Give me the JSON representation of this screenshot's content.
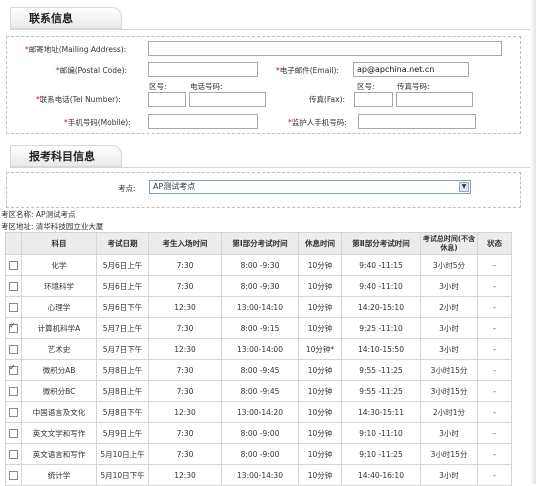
{
  "contact": {
    "title": "联系信息",
    "address_label": "邮寄地址(Mailing Address):",
    "address_value": "",
    "postal_label": "邮编(Postal Code):",
    "postal_value": "",
    "email_label": "电子邮件(Email):",
    "email_value": "ap@apchina.net.cn",
    "tel_label": "联系电话(Tel Number):",
    "area_code_label": "区号:",
    "phone_label": "电话号码:",
    "fax_label": "传真(Fax):",
    "fax_area_label": "区号:",
    "fax_number_label": "传真号码:",
    "mobile_label": "手机号码(Mobile):",
    "guardian_label": "监护人手机号码:"
  },
  "exam": {
    "title": "报考科目信息",
    "site_label": "考点:",
    "site_selected": "AP测试考点",
    "site_name_line": "考区名称: AP测试考点",
    "site_address_line": "考区地址: 清华科技园立业大厦"
  },
  "table": {
    "headers": [
      "科目",
      "考试日期",
      "考生入场时间",
      "第Ⅰ部分考试时间",
      "休息时间",
      "第Ⅱ部分考试时间",
      "考试总时间(不含休息)",
      "状态"
    ],
    "rows": [
      {
        "checked": false,
        "subject": "化学",
        "date": "5月6日上午",
        "entry": "7:30",
        "part1": "8:00 -9:30",
        "break": "10分钟",
        "part2": "9:40 -11:15",
        "total": "3小时5分",
        "status": "-"
      },
      {
        "checked": false,
        "subject": "环境科学",
        "date": "5月6日上午",
        "entry": "7:30",
        "part1": "8:00 -9:30",
        "break": "10分钟",
        "part2": "9:40 -11:10",
        "total": "3小时",
        "status": "-"
      },
      {
        "checked": false,
        "subject": "心理学",
        "date": "5月6日下午",
        "entry": "12:30",
        "part1": "13:00-14:10",
        "break": "10分钟",
        "part2": "14:20-15:10",
        "total": "2小时",
        "status": "-"
      },
      {
        "checked": true,
        "subject": "计算机科学A",
        "date": "5月7日上午",
        "entry": "7:30",
        "part1": "8:00 -9:15",
        "break": "10分钟",
        "part2": "9:25 -11:10",
        "total": "3小时",
        "status": "-"
      },
      {
        "checked": false,
        "subject": "艺术史",
        "date": "5月7日下午",
        "entry": "12:30",
        "part1": "13:00-14:00",
        "break": "10分钟*",
        "part2": "14:10-15:50",
        "total": "3小时",
        "status": "-"
      },
      {
        "checked": true,
        "subject": "微积分AB",
        "date": "5月8日上午",
        "entry": "7:30",
        "part1": "8:00 -9:45",
        "break": "10分钟",
        "part2": "9:55 -11:25",
        "total": "3小时15分",
        "status": "-"
      },
      {
        "checked": false,
        "subject": "微积分BC",
        "date": "5月8日上午",
        "entry": "7:30",
        "part1": "8:00 -9:45",
        "break": "10分钟",
        "part2": "9:55 -11:25",
        "total": "3小时15分",
        "status": "-"
      },
      {
        "checked": false,
        "subject": "中国语言及文化",
        "date": "5月8日下午",
        "entry": "12:30",
        "part1": "13:00-14:20",
        "break": "10分钟",
        "part2": "14:30-15:11",
        "total": "2小时1分",
        "status": "-"
      },
      {
        "checked": false,
        "subject": "英文文学和写作",
        "date": "5月9日上午",
        "entry": "7:30",
        "part1": "8:00 -9:00",
        "break": "10分钟",
        "part2": "9:10 -11:10",
        "total": "3小时",
        "status": "-"
      },
      {
        "checked": false,
        "subject": "英文语言和写作",
        "date": "5月10日上午",
        "entry": "7:30",
        "part1": "8:00 -9:00",
        "break": "10分钟",
        "part2": "9:10 -11:25",
        "total": "3小时15分",
        "status": "-"
      },
      {
        "checked": false,
        "subject": "统计学",
        "date": "5月10日下午",
        "entry": "12:30",
        "part1": "13:00-14:30",
        "break": "10分钟",
        "part2": "14:40-16:10",
        "total": "3小时",
        "status": "-"
      }
    ]
  }
}
